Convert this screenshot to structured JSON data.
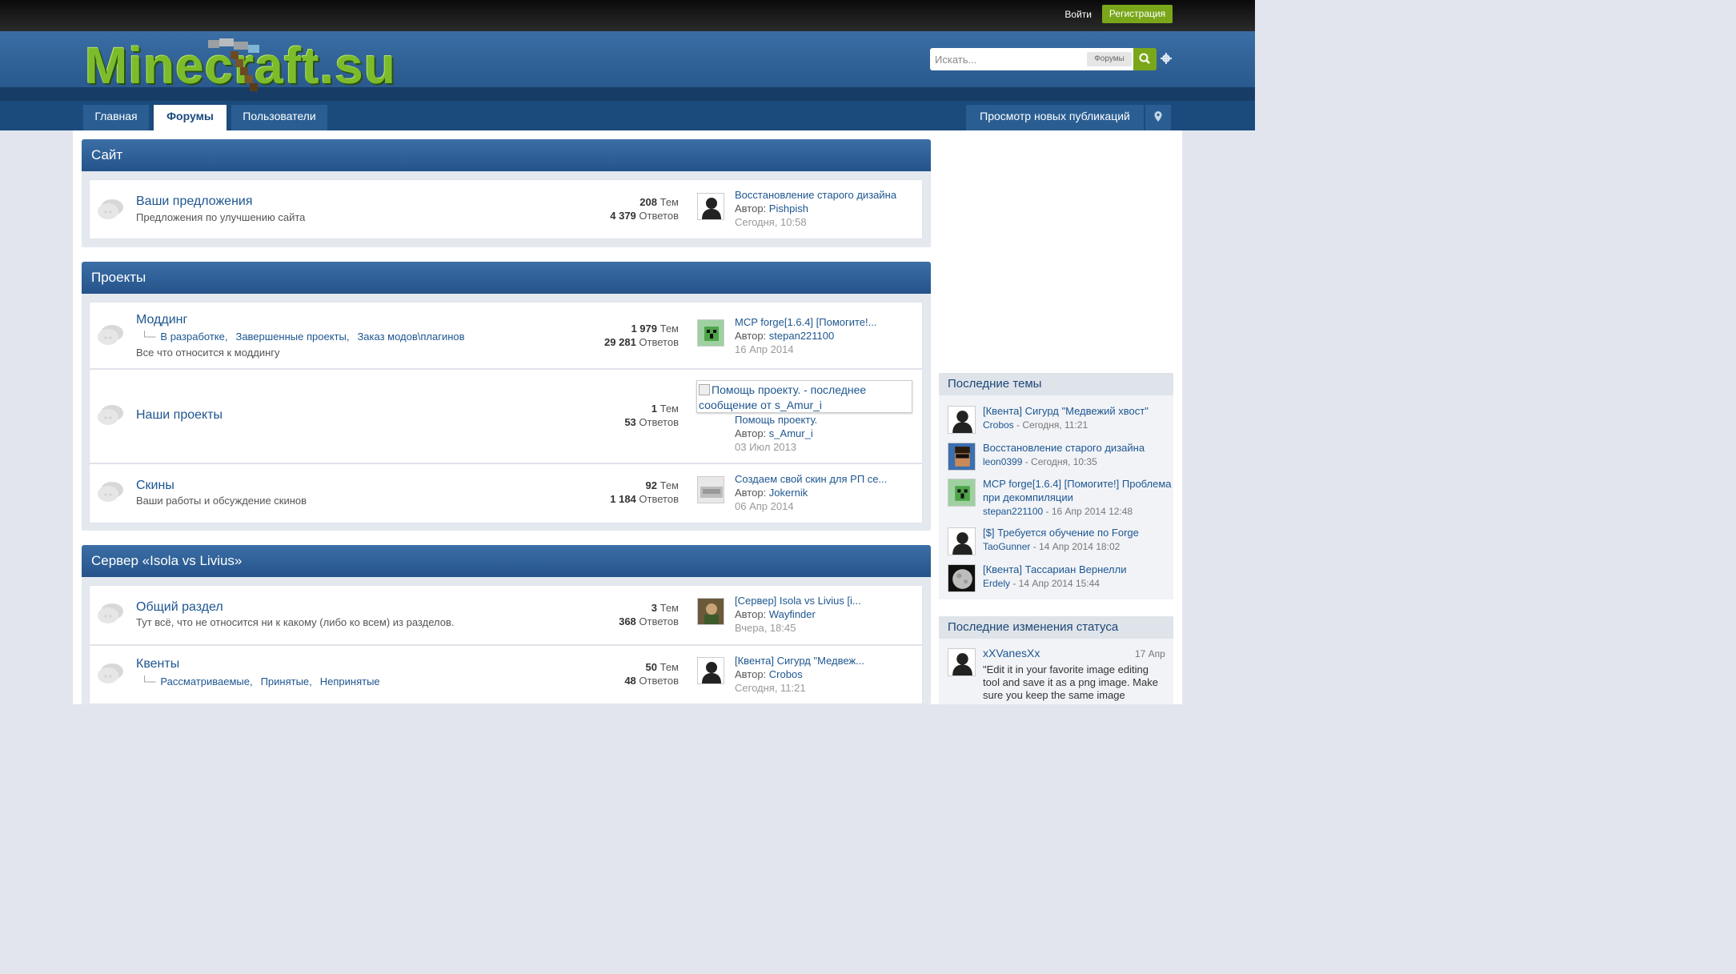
{
  "topbar": {
    "login": "Войти",
    "register": "Регистрация"
  },
  "header": {
    "logo_text": "Minecraft.su",
    "search_placeholder": "Искать...",
    "search_scope": "Форумы"
  },
  "nav": {
    "tabs": [
      "Главная",
      "Форумы",
      "Пользователи"
    ],
    "new_posts": "Просмотр новых публикаций"
  },
  "categories": [
    {
      "title": "Сайт"
    },
    {
      "title": "Проекты"
    },
    {
      "title": "Сервер «Isola vs Livius»"
    }
  ],
  "forums": [
    {
      "name": "Ваши предложения",
      "desc": "Предложения по улучшению сайта",
      "topics": "208",
      "topics_label": "Тем",
      "posts": "4 379",
      "posts_label": "Ответов",
      "last_title": "Восстановление старого дизайна",
      "author_label": "Автор:",
      "last_author": "Pishpish",
      "last_date": "Сегодня, 10:58"
    },
    {
      "name": "Моддинг",
      "subs": [
        "В разработке,",
        "Завершенные проекты,",
        "Заказ модов\\плагинов"
      ],
      "desc": "Все что относится к моддингу",
      "topics": "1 979",
      "topics_label": "Тем",
      "posts": "29 281",
      "posts_label": "Ответов",
      "last_title": "MCP forge[1.6.4] [Помогите!...",
      "author_label": "Автор:",
      "last_author": "stepan221100",
      "last_date": "16 Апр 2014"
    },
    {
      "name": "Наши проекты",
      "topics": "1",
      "topics_label": "Тем",
      "posts": "53",
      "posts_label": "Ответов",
      "broken_alt": "Помощь проекту. - последнее сообщение от s_Amur_i",
      "last_title": "Помощь проекту.",
      "author_label": "Автор:",
      "last_author": "s_Amur_i",
      "last_date": "03 Июл 2013"
    },
    {
      "name": "Скины",
      "desc": "Ваши работы и обсуждение скинов",
      "topics": "92",
      "topics_label": "Тем",
      "posts": "1 184",
      "posts_label": "Ответов",
      "last_title": "Создаем свой скин для РП се...",
      "author_label": "Автор:",
      "last_author": "Jokernik",
      "last_date": "06 Апр 2014"
    },
    {
      "name": "Общий раздел",
      "desc": "Тут всё, что не относится ни к какому (либо ко всем) из разделов.",
      "topics": "3",
      "topics_label": "Тем",
      "posts": "368",
      "posts_label": "Ответов",
      "last_title": "[Сервер] Isola vs Livius [i...",
      "author_label": "Автор:",
      "last_author": "Wayfinder",
      "last_date": "Вчера, 18:45"
    },
    {
      "name": "Квенты",
      "subs": [
        "Рассматриваемые,",
        "Принятые,",
        "Непринятые"
      ],
      "topics": "50",
      "topics_label": "Тем",
      "posts": "48",
      "posts_label": "Ответов",
      "last_title": "[Квента] Сигурд \"Медвеж...",
      "author_label": "Автор:",
      "last_author": "Crobos",
      "last_date": "Сегодня, 11:21"
    }
  ],
  "sidebar": {
    "recent_title": "Последние темы",
    "recent": [
      {
        "title": "[Квента] Сигурд \"Медвежий хвост\"",
        "user": "Crobos",
        "date": " - Сегодня, 11:21"
      },
      {
        "title": "Восстановление старого дизайна",
        "user": "leon0399",
        "date": " - Сегодня, 10:35"
      },
      {
        "title": "MCP forge[1.6.4] [Помогите!] Проблема при декомпиляции",
        "user": "stepan221100",
        "date": " - 16 Апр 2014 12:48"
      },
      {
        "title": "[$] Требуется обучение по Forge",
        "user": "TaoGunner",
        "date": " - 14 Апр 2014 18:02"
      },
      {
        "title": "[Квента] Тассариан Вернелли",
        "user": "Erdely",
        "date": " - 14 Апр 2014 15:44"
      }
    ],
    "status_title": "Последние изменения статуса",
    "status": {
      "user": "xXVanesXx",
      "date": "17 Апр",
      "text": "\"Edit it in your favorite image editing tool and save it as a png image. Make sure you keep the same image"
    }
  },
  "colors": {
    "accent": "#7aa71a",
    "link": "#1e5690",
    "nav": "#1b4a7c"
  }
}
